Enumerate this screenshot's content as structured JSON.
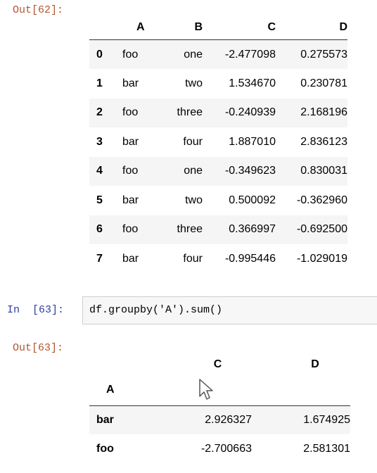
{
  "out62": {
    "prompt": "Out[62]:",
    "columns": [
      "A",
      "B",
      "C",
      "D"
    ],
    "rows": [
      {
        "idx": "0",
        "A": "foo",
        "B": "one",
        "C": "-2.477098",
        "D": "0.275573"
      },
      {
        "idx": "1",
        "A": "bar",
        "B": "two",
        "C": "1.534670",
        "D": "0.230781"
      },
      {
        "idx": "2",
        "A": "foo",
        "B": "three",
        "C": "-0.240939",
        "D": "2.168196"
      },
      {
        "idx": "3",
        "A": "bar",
        "B": "four",
        "C": "1.887010",
        "D": "2.836123"
      },
      {
        "idx": "4",
        "A": "foo",
        "B": "one",
        "C": "-0.349623",
        "D": "0.830031"
      },
      {
        "idx": "5",
        "A": "bar",
        "B": "two",
        "C": "0.500092",
        "D": "-0.362960"
      },
      {
        "idx": "6",
        "A": "foo",
        "B": "three",
        "C": "0.366997",
        "D": "-0.692500"
      },
      {
        "idx": "7",
        "A": "bar",
        "B": "four",
        "C": "-0.995446",
        "D": "-1.029019"
      }
    ]
  },
  "in63": {
    "prompt": "In  [63]:",
    "code": "df.groupby('A').sum()"
  },
  "out63": {
    "prompt": "Out[63]:",
    "columns": [
      "C",
      "D"
    ],
    "index_name": "A",
    "rows": [
      {
        "idx": "bar",
        "C": "2.926327",
        "D": "1.674925"
      },
      {
        "idx": "foo",
        "C": "-2.700663",
        "D": "2.581301"
      }
    ]
  },
  "colors": {
    "out_prompt": "#b5542f",
    "in_prompt": "#303f9f",
    "row_shade": "#f5f5f5"
  },
  "icons": {
    "cursor": "mouse-pointer-icon"
  }
}
